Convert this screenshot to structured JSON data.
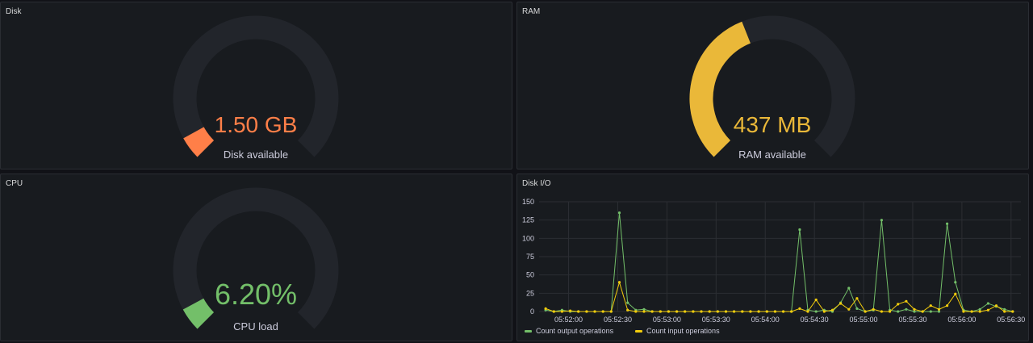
{
  "panels": {
    "disk": {
      "title": "Disk",
      "value": "1.50 GB",
      "label": "Disk available",
      "fraction": 0.06,
      "color": "#ff7f48"
    },
    "ram": {
      "title": "RAM",
      "value": "437 MB",
      "label": "RAM available",
      "fraction": 0.42,
      "color": "#eab839"
    },
    "cpu": {
      "title": "CPU",
      "value": "6.20%",
      "label": "CPU load",
      "fraction": 0.062,
      "color": "#73bf69"
    },
    "diskio": {
      "title": "Disk I/O"
    }
  },
  "colors": {
    "gauge_track": "#22252b",
    "series_output": "#73bf69",
    "series_input": "#f2cc0c"
  },
  "chart_data": {
    "type": "line",
    "title": "Disk I/O",
    "ylim": [
      0,
      150
    ],
    "y_ticks": [
      0,
      25,
      50,
      75,
      100,
      125,
      150
    ],
    "x_tick_labels": [
      "05:52:00",
      "05:52:30",
      "05:53:00",
      "05:53:30",
      "05:54:00",
      "05:54:30",
      "05:55:00",
      "05:55:30",
      "05:56:00",
      "05:56:30"
    ],
    "grid": true,
    "legend": "bottom-left",
    "x": [
      "05:51:46",
      "05:51:51",
      "05:51:56",
      "05:52:01",
      "05:52:06",
      "05:52:11",
      "05:52:16",
      "05:52:21",
      "05:52:26",
      "05:52:31",
      "05:52:36",
      "05:52:41",
      "05:52:46",
      "05:52:51",
      "05:52:56",
      "05:53:01",
      "05:53:06",
      "05:53:11",
      "05:53:16",
      "05:53:21",
      "05:53:26",
      "05:53:31",
      "05:53:36",
      "05:53:41",
      "05:53:46",
      "05:53:51",
      "05:53:56",
      "05:54:01",
      "05:54:06",
      "05:54:11",
      "05:54:16",
      "05:54:21",
      "05:54:26",
      "05:54:31",
      "05:54:36",
      "05:54:41",
      "05:54:46",
      "05:54:51",
      "05:54:56",
      "05:55:01",
      "05:55:06",
      "05:55:11",
      "05:55:16",
      "05:55:21",
      "05:55:26",
      "05:55:31",
      "05:55:36",
      "05:55:41",
      "05:55:46",
      "05:55:51",
      "05:55:56",
      "05:56:01",
      "05:56:06",
      "05:56:11",
      "05:56:16",
      "05:56:21",
      "05:56:26",
      "05:56:31"
    ],
    "series": [
      {
        "name": "Count output operations",
        "color": "#73bf69",
        "values": [
          2,
          0,
          2,
          0,
          0,
          0,
          0,
          0,
          0,
          135,
          12,
          2,
          3,
          0,
          0,
          0,
          0,
          0,
          0,
          0,
          0,
          0,
          0,
          0,
          0,
          0,
          0,
          0,
          0,
          0,
          0,
          112,
          2,
          0,
          2,
          0,
          12,
          32,
          4,
          0,
          2,
          125,
          2,
          0,
          3,
          0,
          0,
          0,
          0,
          120,
          40,
          2,
          0,
          3,
          11,
          7,
          3,
          0
        ]
      },
      {
        "name": "Count input operations",
        "color": "#f2cc0c",
        "values": [
          4,
          0,
          0,
          1,
          0,
          0,
          0,
          0,
          0,
          40,
          2,
          0,
          0,
          0,
          0,
          0,
          0,
          0,
          0,
          0,
          0,
          0,
          0,
          0,
          0,
          0,
          0,
          0,
          0,
          0,
          0,
          4,
          0,
          16,
          0,
          2,
          11,
          3,
          18,
          0,
          3,
          0,
          0,
          10,
          14,
          3,
          0,
          8,
          3,
          8,
          24,
          0,
          0,
          0,
          2,
          8,
          0,
          0
        ]
      }
    ]
  }
}
